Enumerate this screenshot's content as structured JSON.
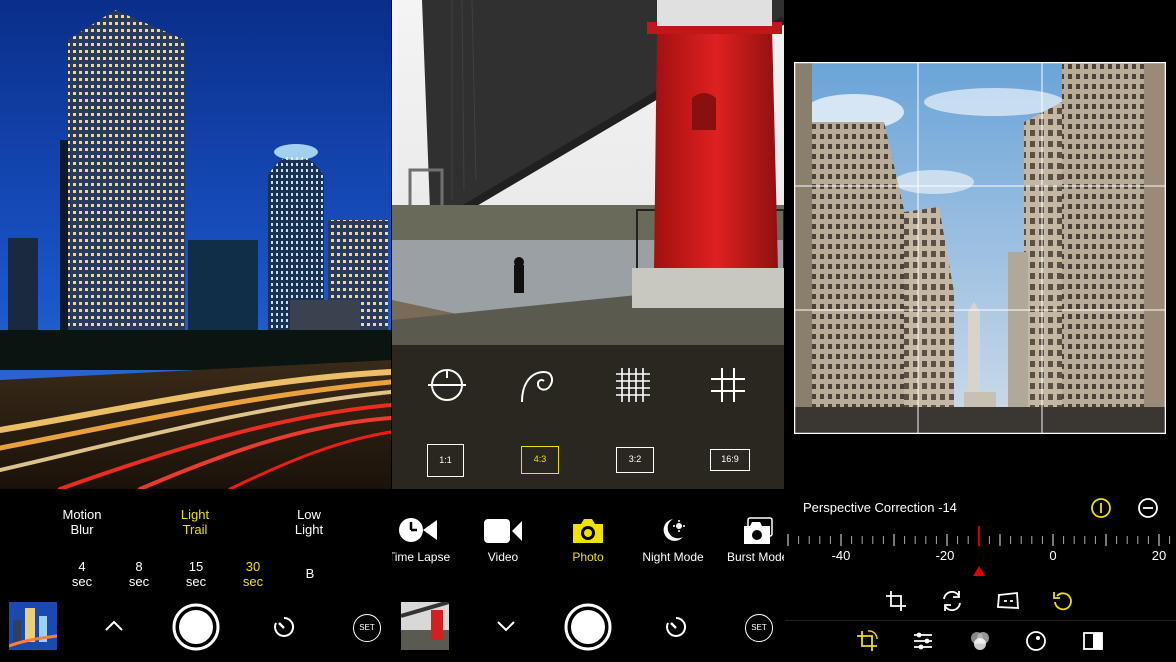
{
  "panel1": {
    "modes": [
      {
        "label": "Motion\nBlur",
        "active": false
      },
      {
        "label": "Light\nTrail",
        "active": true
      },
      {
        "label": "Low\nLight",
        "active": false
      }
    ],
    "durations": [
      {
        "label": "4\nsec",
        "active": false
      },
      {
        "label": "8\nsec",
        "active": false
      },
      {
        "label": "15\nsec",
        "active": false
      },
      {
        "label": "30\nsec",
        "active": true
      },
      {
        "label": "B",
        "active": false
      }
    ],
    "set_label": "SET"
  },
  "panel2": {
    "ratios": [
      {
        "label": "1:1",
        "active": false
      },
      {
        "label": "4:3",
        "active": true
      },
      {
        "label": "3:2",
        "active": false
      },
      {
        "label": "16:9",
        "active": false
      }
    ],
    "modes": [
      {
        "label": "Time Lapse",
        "icon": "time-lapse-icon",
        "active": false
      },
      {
        "label": "Video",
        "icon": "video-camera-icon",
        "active": false
      },
      {
        "label": "Photo",
        "icon": "camera-icon",
        "active": true
      },
      {
        "label": "Night Mode",
        "icon": "night-mode-icon",
        "active": false
      },
      {
        "label": "Burst Mode",
        "icon": "burst-mode-icon",
        "active": false
      }
    ],
    "set_label": "SET"
  },
  "panel3": {
    "perspective_label": "Perspective Correction -14",
    "ruler": {
      "min": -40,
      "max": 20,
      "value": -14,
      "labels": [
        "-40",
        "-20",
        "0",
        "20"
      ]
    }
  },
  "colors": {
    "accent": "#f0e000",
    "marker": "#e00000"
  }
}
